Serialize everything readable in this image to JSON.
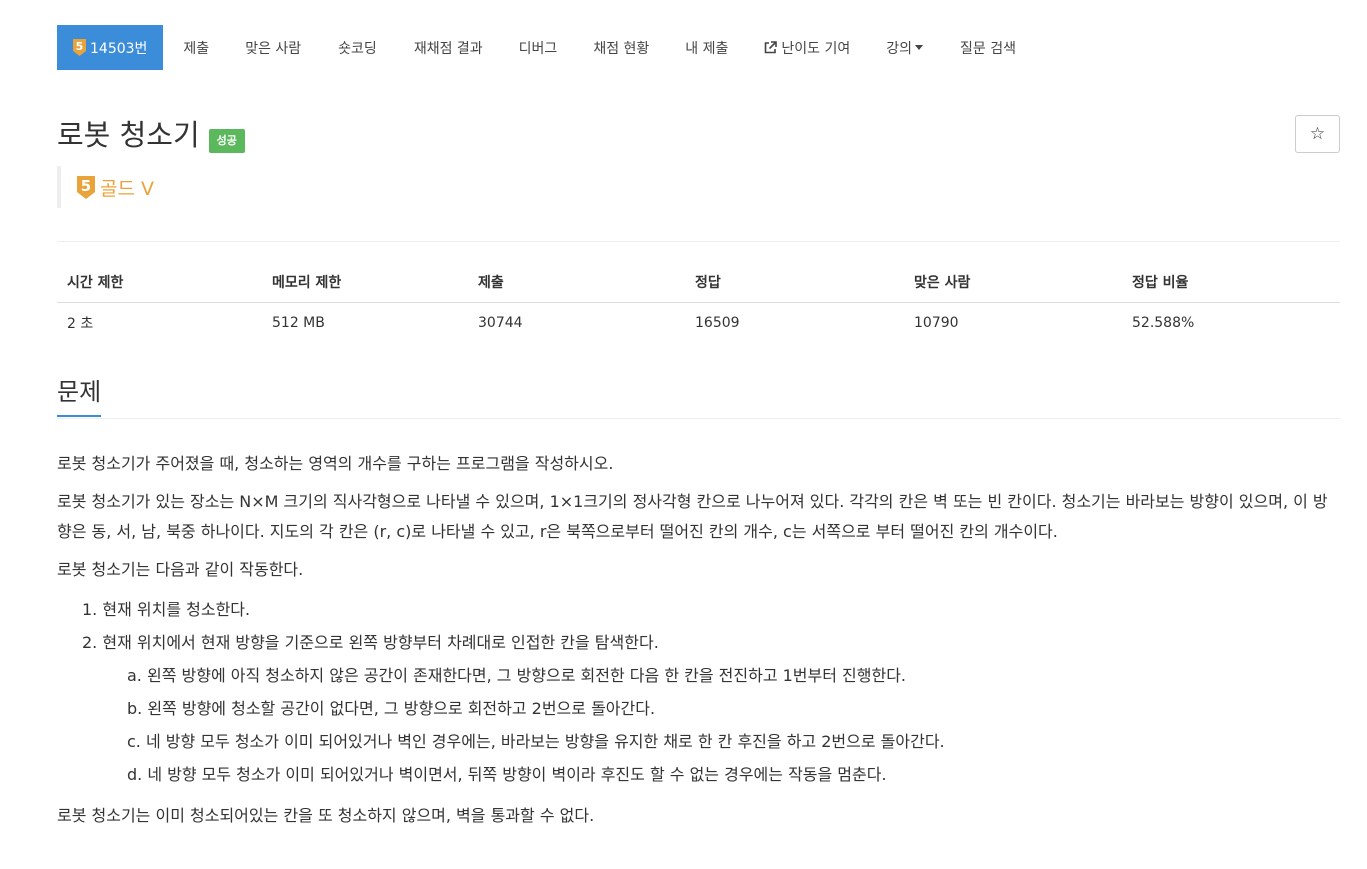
{
  "colors": {
    "accent": "#3C8DD9",
    "success": "#5CB85C",
    "gold": "#E8A33A"
  },
  "nav": {
    "problem_number": "14503번",
    "tier_number": "5",
    "items": [
      {
        "label": "제출"
      },
      {
        "label": "맞은 사람"
      },
      {
        "label": "숏코딩"
      },
      {
        "label": "재채점 결과"
      },
      {
        "label": "디버그"
      },
      {
        "label": "채점 현황"
      },
      {
        "label": "내 제출"
      },
      {
        "label": "난이도 기여",
        "icon": "external-link-icon"
      },
      {
        "label": "강의",
        "icon": "caret-down-icon"
      },
      {
        "label": "질문 검색"
      }
    ]
  },
  "problem": {
    "title": "로봇 청소기",
    "status_badge": "성공",
    "tier_number": "5",
    "tier_label": "골드 V",
    "star_icon": "☆"
  },
  "stats": {
    "headers": [
      "시간 제한",
      "메모리 제한",
      "제출",
      "정답",
      "맞은 사람",
      "정답 비율"
    ],
    "values": [
      "2 초",
      "512 MB",
      "30744",
      "16509",
      "10790",
      "52.588%"
    ]
  },
  "section": {
    "title": "문제"
  },
  "content": {
    "p1": "로봇 청소기가 주어졌을 때, 청소하는 영역의 개수를 구하는 프로그램을 작성하시오.",
    "p2": "로봇 청소기가 있는 장소는 N×M 크기의 직사각형으로 나타낼 수 있으며, 1×1크기의 정사각형 칸으로 나누어져 있다. 각각의 칸은 벽 또는 빈 칸이다. 청소기는 바라보는 방향이 있으며, 이 방향은 동, 서, 남, 북중 하나이다. 지도의 각 칸은 (r, c)로 나타낼 수 있고, r은 북쪽으로부터 떨어진 칸의 개수, c는 서쪽으로 부터 떨어진 칸의 개수이다.",
    "p3": "로봇 청소기는 다음과 같이 작동한다.",
    "steps": [
      "1. 현재 위치를 청소한다.",
      "2. 현재 위치에서 현재 방향을 기준으로 왼쪽 방향부터 차례대로 인접한 칸을 탐색한다."
    ],
    "substeps": [
      "a. 왼쪽 방향에 아직 청소하지 않은 공간이 존재한다면, 그 방향으로 회전한 다음 한 칸을 전진하고 1번부터 진행한다.",
      "b. 왼쪽 방향에 청소할 공간이 없다면, 그 방향으로 회전하고 2번으로 돌아간다.",
      "c. 네 방향 모두 청소가 이미 되어있거나 벽인 경우에는, 바라보는 방향을 유지한 채로 한 칸 후진을 하고 2번으로 돌아간다.",
      "d. 네 방향 모두 청소가 이미 되어있거나 벽이면서, 뒤쪽 방향이 벽이라 후진도 할 수 없는 경우에는 작동을 멈춘다."
    ],
    "p4": "로봇 청소기는 이미 청소되어있는 칸을 또 청소하지 않으며, 벽을 통과할 수 없다."
  }
}
